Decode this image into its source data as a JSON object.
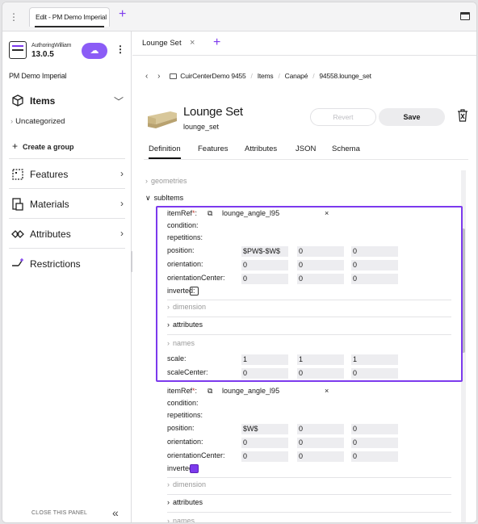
{
  "window": {
    "tab_title": "Edit - PM Demo Imperial"
  },
  "sidebar": {
    "account_name": "AuthoringWilliam",
    "version": "13.0.5",
    "project": "PM Demo Imperial",
    "items_label": "Items",
    "uncategorized": "Uncategorized",
    "create_group": "Create a group",
    "features": "Features",
    "materials": "Materials",
    "attributes": "Attributes",
    "restrictions": "Restrictions",
    "close_panel": "CLOSE THIS PANEL"
  },
  "main": {
    "tab_label": "Lounge Set",
    "breadcrumb": [
      "CuirCenterDemo 9455",
      "Items",
      "Canapé",
      "94558.lounge_set"
    ],
    "title": "Lounge Set",
    "subtitle": "lounge_set",
    "revert": "Revert",
    "save": "Save",
    "tabs": [
      "Definition",
      "Features",
      "Attributes",
      "JSON",
      "Schema"
    ],
    "active_tab": "Definition",
    "geometries": "geometries",
    "subitems": "subItems",
    "sub_items": [
      {
        "itemRef_label": "itemRef",
        "itemRef": "lounge_angle_l95",
        "condition": "condition:",
        "repetitions": "repetitions:",
        "position": [
          "$PW$-$W$",
          "0",
          "0"
        ],
        "orientation": [
          "0",
          "0",
          "0"
        ],
        "orientationCenter": [
          "0",
          "0",
          "0"
        ],
        "inverted": false,
        "dimension": "dimension",
        "attributes": "attributes",
        "names": "names",
        "scale": [
          "1",
          "1",
          "1"
        ],
        "scaleCenter": [
          "0",
          "0",
          "0"
        ]
      },
      {
        "itemRef_label": "itemRef",
        "itemRef": "lounge_angle_l95",
        "condition": "condition:",
        "repetitions": "repetitions:",
        "position": [
          "$W$",
          "0",
          "0"
        ],
        "orientation": [
          "0",
          "0",
          "0"
        ],
        "orientationCenter": [
          "0",
          "0",
          "0"
        ],
        "inverted": true,
        "dimension": "dimension",
        "attributes": "attributes",
        "names": "names"
      }
    ],
    "labels": {
      "position": "position:",
      "orientation": "orientation:",
      "orientationCenter": "orientationCenter:",
      "inverted": "inverted:",
      "scale": "scale:",
      "scaleCenter": "scaleCenter:"
    }
  },
  "colors": {
    "accent": "#7c3aed",
    "accent_button": "#8b5cf6"
  },
  "icons": [
    "menu-dots-icon",
    "add-tab-icon",
    "window-icon",
    "account-icon",
    "cloud-upload-icon",
    "kebab-icon",
    "cube-icon",
    "features-icon",
    "materials-icon",
    "attributes-icon",
    "restrictions-icon",
    "trash-icon",
    "external-link-icon"
  ]
}
